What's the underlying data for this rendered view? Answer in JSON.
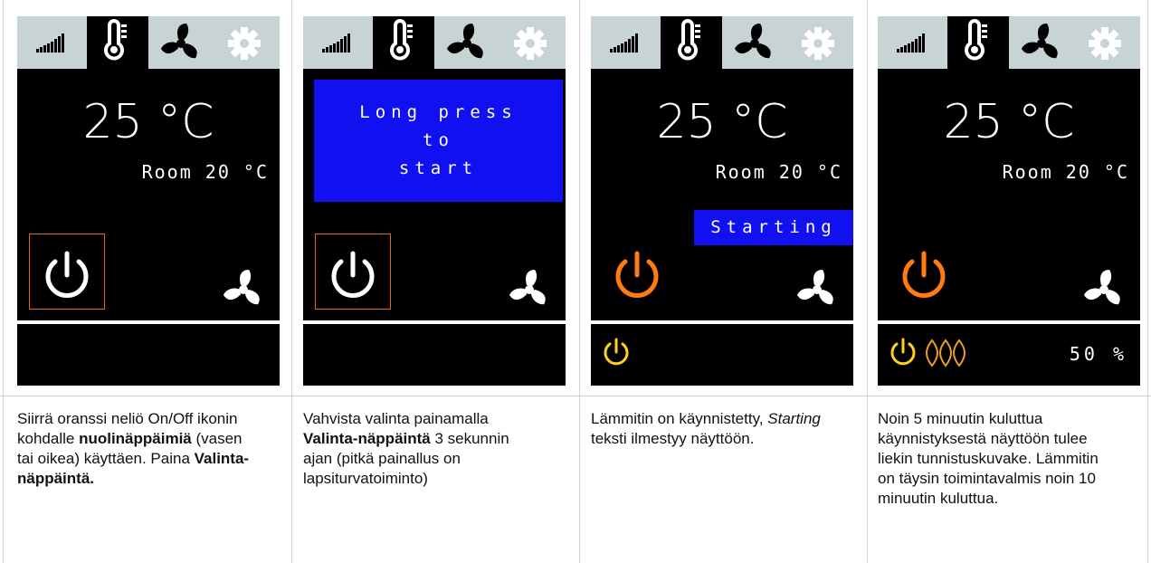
{
  "panels": [
    {
      "temperature": "25 °C",
      "room": "Room 20 °C"
    },
    {
      "message": [
        "Long press",
        "to",
        "start"
      ]
    },
    {
      "temperature": "25 °C",
      "room": "Room 20 °C",
      "status": "Starting"
    },
    {
      "temperature": "25 °C",
      "room": "Room 20 °C",
      "percent": "50 %"
    }
  ],
  "captions": [
    {
      "t1": "Siirrä oranssi neliö On/Off ikonin kohdalle ",
      "b1": "nuolinäppäimiä",
      "t2": " (vasen tai oikea) käyttäen. Paina ",
      "b2": "Valinta-näppäintä."
    },
    {
      "t1": "Vahvista valinta painamalla ",
      "b1": "Valinta-näppäintä",
      "t2": " 3 sekunnin ajan (pitkä painallus on lapsiturvatoiminto)"
    },
    {
      "i1": "Starting",
      "t1": "Lämmitin on käynnistetty, ",
      "t2": " teksti ilmestyy näyttöön."
    },
    {
      "t1": "Noin 5 minuutin kuluttua käynnistyksestä näyttöön tulee liekin tunnistuskuvake. Lämmitin on täysin toimintavalmis noin 10 minuutin kuluttua."
    }
  ],
  "colors": {
    "tabbar": "#c8d3d6",
    "selection": "#e36b00",
    "power_on": "#ff7a10",
    "standby": "#ffd21a",
    "message_bg": "#1010f0"
  }
}
